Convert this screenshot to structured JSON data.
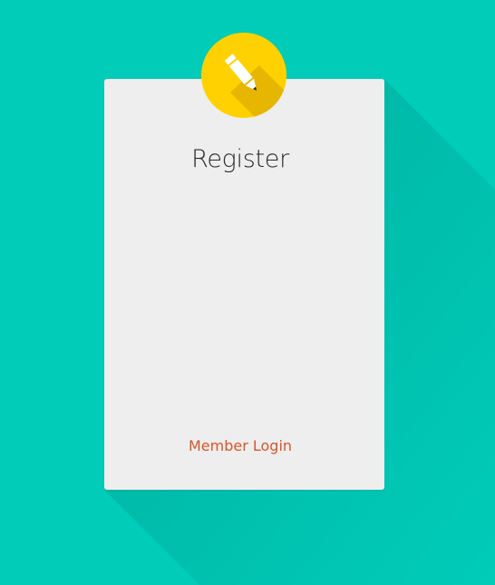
{
  "form": {
    "title": "Register",
    "member_login_label": "Member Login"
  },
  "icons": {
    "badge": "pencil-icon"
  },
  "colors": {
    "background": "#00ccb8",
    "card": "#eeeeee",
    "badge": "#ffd100",
    "link": "#d9542b"
  }
}
